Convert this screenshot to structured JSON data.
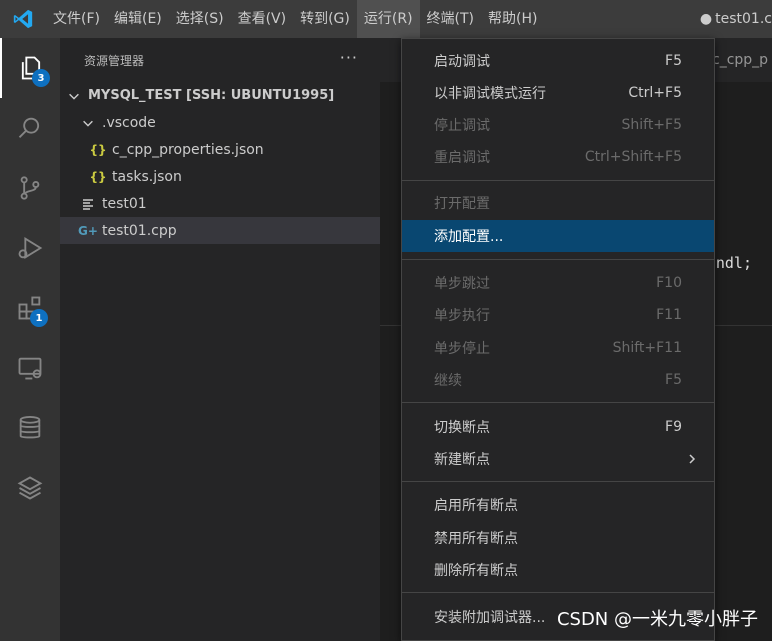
{
  "menubar": {
    "items": [
      {
        "label": "文件(F)"
      },
      {
        "label": "编辑(E)"
      },
      {
        "label": "选择(S)"
      },
      {
        "label": "查看(V)"
      },
      {
        "label": "转到(G)"
      },
      {
        "label": "运行(R)"
      },
      {
        "label": "终端(T)"
      },
      {
        "label": "帮助(H)"
      }
    ],
    "window_title": "test01.c"
  },
  "activitybar": {
    "explorer_badge": "3",
    "extensions_badge": "1"
  },
  "sidebar": {
    "title": "资源管理器",
    "more": "···",
    "root": "MYSQL_TEST [SSH: UBUNTU1995]",
    "tree": [
      {
        "label": ".vscode"
      },
      {
        "label": "c_cpp_properties.json"
      },
      {
        "label": "tasks.json"
      },
      {
        "label": "test01"
      },
      {
        "label": "test01.cpp"
      }
    ]
  },
  "editor": {
    "tab_partial": "c_cpp_p",
    "code_fragment": "ndl;"
  },
  "run_menu": {
    "items": [
      {
        "label": "启动调试",
        "shortcut": "F5"
      },
      {
        "label": "以非调试模式运行",
        "shortcut": "Ctrl+F5"
      },
      {
        "label": "停止调试",
        "shortcut": "Shift+F5"
      },
      {
        "label": "重启调试",
        "shortcut": "Ctrl+Shift+F5"
      },
      {
        "label": "打开配置",
        "shortcut": ""
      },
      {
        "label": "添加配置...",
        "shortcut": ""
      },
      {
        "label": "单步跳过",
        "shortcut": "F10"
      },
      {
        "label": "单步执行",
        "shortcut": "F11"
      },
      {
        "label": "单步停止",
        "shortcut": "Shift+F11"
      },
      {
        "label": "继续",
        "shortcut": "F5"
      },
      {
        "label": "切换断点",
        "shortcut": "F9"
      },
      {
        "label": "新建断点",
        "shortcut": ""
      },
      {
        "label": "启用所有断点",
        "shortcut": ""
      },
      {
        "label": "禁用所有断点",
        "shortcut": ""
      },
      {
        "label": "删除所有断点",
        "shortcut": ""
      },
      {
        "label": "安装附加调试器...",
        "shortcut": ""
      }
    ]
  },
  "watermark": "CSDN @一米九零小胖子",
  "colors": {
    "accent": "#0e70c0",
    "highlight": "#094771",
    "menubar": "#3c3c3c",
    "sidebar": "#252526",
    "editor": "#1e1e1e",
    "json_icon": "#cbcb41",
    "cpp_icon": "#519aba"
  }
}
